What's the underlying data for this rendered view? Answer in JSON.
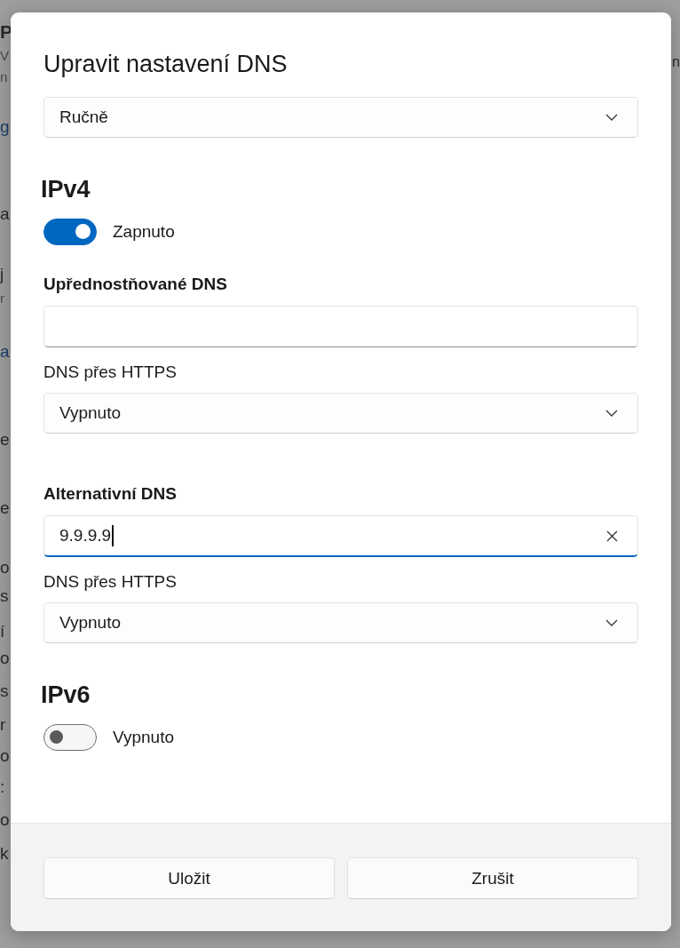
{
  "background": {
    "fragments": [
      {
        "text": "P",
        "kind": "heading"
      },
      {
        "text": "V",
        "kind": "note"
      },
      {
        "text": "n",
        "kind": "note"
      },
      {
        "text": "g",
        "kind": "link"
      },
      {
        "text": "a",
        "kind": "text"
      },
      {
        "text": "j",
        "kind": "text"
      },
      {
        "text": "r",
        "kind": "note"
      },
      {
        "text": "a",
        "kind": "link"
      },
      {
        "text": "e",
        "kind": "text"
      },
      {
        "text": "e",
        "kind": "text"
      },
      {
        "text": "o",
        "kind": "text"
      },
      {
        "text": "s",
        "kind": "text"
      },
      {
        "text": "í",
        "kind": "text"
      },
      {
        "text": "o",
        "kind": "text"
      },
      {
        "text": "s",
        "kind": "text"
      },
      {
        "text": "r",
        "kind": "text"
      },
      {
        "text": "o",
        "kind": "text"
      },
      {
        "text": ":",
        "kind": "text"
      },
      {
        "text": "o",
        "kind": "text"
      },
      {
        "text": "k",
        "kind": "text"
      }
    ],
    "right_fragment": "n"
  },
  "dialog": {
    "title": "Upravit nastavení DNS",
    "mode": {
      "value": "Ručně"
    },
    "sections": [
      {
        "heading": "IPv4",
        "toggle": {
          "on": true,
          "label": "Zapnuto"
        },
        "servers": [
          {
            "label": "Upřednostňované DNS",
            "field": {
              "focused": false
            },
            "https_label": "DNS přes HTTPS",
            "https": {
              "value": "Vypnuto"
            }
          },
          {
            "label": "Alternativní DNS",
            "field": {
              "value": "9.9.9.9",
              "focused": true
            },
            "https_label": "DNS přes HTTPS",
            "https": {
              "value": "Vypnuto"
            }
          }
        ]
      },
      {
        "heading": "IPv6",
        "toggle": {
          "on": false,
          "label": "Vypnuto"
        }
      }
    ],
    "buttons": [
      "Uložit",
      "Zrušit"
    ]
  }
}
